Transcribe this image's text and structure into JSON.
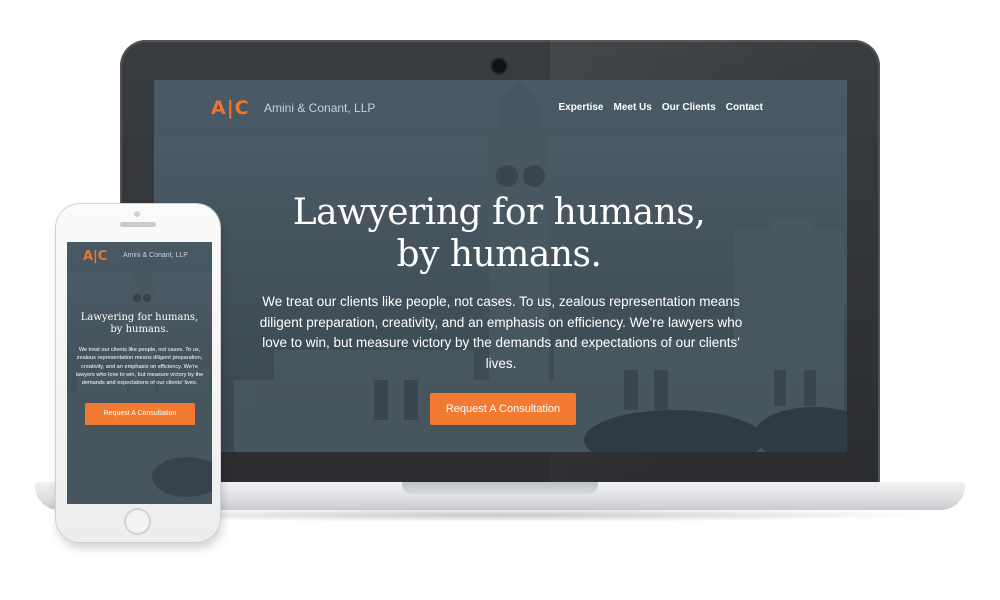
{
  "brand": {
    "logo": "A|C",
    "name": "Amini & Conant, LLP",
    "accent_color": "#f37a30"
  },
  "nav": {
    "items": [
      "Expertise",
      "Meet Us",
      "Our Clients",
      "Contact"
    ]
  },
  "hero": {
    "title_line1": "Lawyering for humans,",
    "title_line2": "by humans.",
    "description": "We treat our clients like people, not cases. To us, zealous representation means diligent preparation, creativity, and an emphasis on efficiency. We're lawyers who love to win, but measure victory by the demands and expectations of our clients' lives.",
    "cta_label": "Request A Consultation"
  },
  "devices": [
    "laptop",
    "phone"
  ]
}
